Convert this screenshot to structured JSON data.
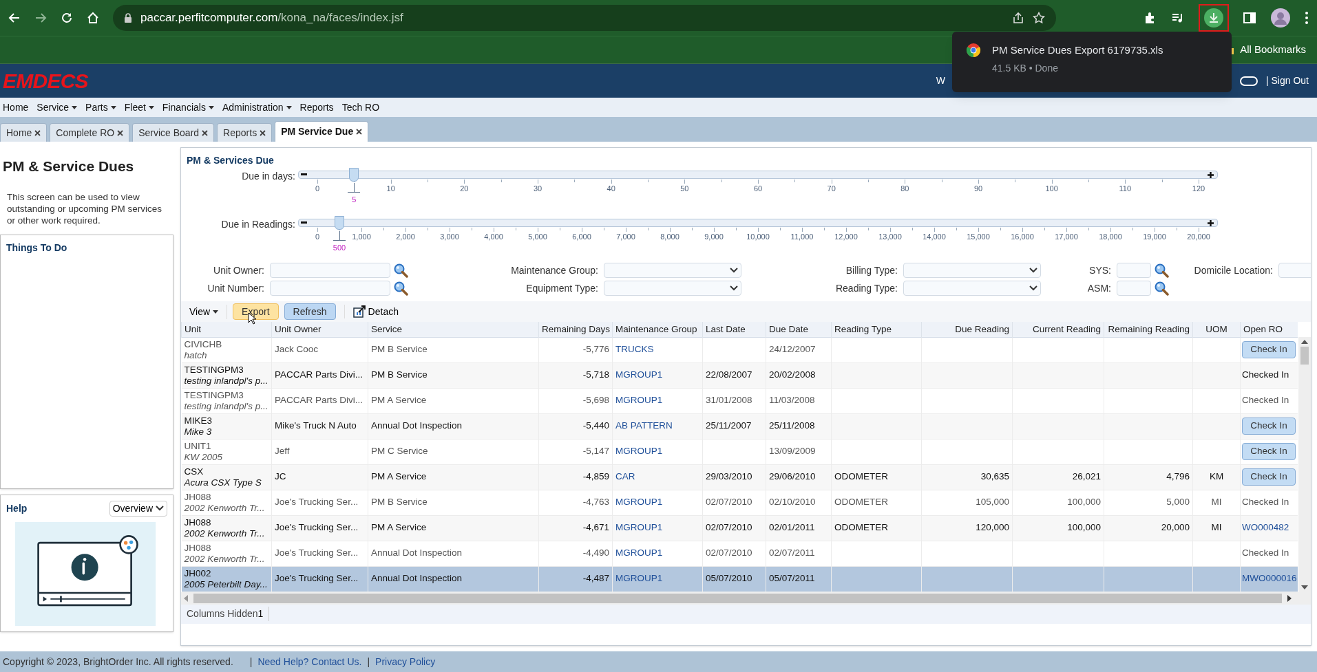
{
  "browser": {
    "url_host": "paccar.perfitcomputer.com",
    "url_path": "/kona_na/faces/index.jsf",
    "bookmarks_label": "All Bookmarks"
  },
  "download_popup": {
    "file_name": "PM Service Dues Export 6179735.xls",
    "details": "41.5 KB • Done"
  },
  "app_header": {
    "logo": "EMDECS",
    "welcome_partial": "W",
    "sign_out": "| Sign Out"
  },
  "menu": [
    {
      "label": "Home",
      "dropdown": false
    },
    {
      "label": "Service",
      "dropdown": true
    },
    {
      "label": "Parts",
      "dropdown": true
    },
    {
      "label": "Fleet",
      "dropdown": true
    },
    {
      "label": "Financials",
      "dropdown": true
    },
    {
      "label": "Administration",
      "dropdown": true
    },
    {
      "label": "Reports",
      "dropdown": false
    },
    {
      "label": "Tech RO",
      "dropdown": false
    }
  ],
  "tabs": [
    {
      "label": "Home",
      "selected": false
    },
    {
      "label": "Complete RO",
      "selected": false
    },
    {
      "label": "Service Board",
      "selected": false
    },
    {
      "label": "Reports",
      "selected": false
    },
    {
      "label": "PM Service Due",
      "selected": true
    }
  ],
  "sidebar": {
    "title": "PM & Service Dues",
    "description": "This screen can be used to view outstanding or upcoming PM services or other work required.",
    "things_to_do": "Things To Do",
    "help_title": "Help",
    "help_select": "Overview"
  },
  "panel_title": "PM & Services Due",
  "sliders": [
    {
      "label": "Due in days:",
      "level": 0.0417,
      "value": "5",
      "ticks": [
        "0",
        "10",
        "20",
        "30",
        "40",
        "50",
        "60",
        "70",
        "80",
        "90",
        "100",
        "110",
        "120"
      ]
    },
    {
      "label": "Due in Readings:",
      "level": 0.025,
      "value": "500",
      "ticks": [
        "0",
        "1,000",
        "2,000",
        "3,000",
        "4,000",
        "5,000",
        "6,000",
        "7,000",
        "8,000",
        "9,000",
        "10,000",
        "11,000",
        "12,000",
        "13,000",
        "14,000",
        "15,000",
        "16,000",
        "17,000",
        "18,000",
        "19,000",
        "20,000"
      ]
    }
  ],
  "filter_columns": [
    [
      {
        "label": "Unit Owner:",
        "kind": "lookup"
      },
      {
        "label": "Unit Number:",
        "kind": "lookup"
      }
    ],
    [
      {
        "label": "Maintenance Group:",
        "kind": "select"
      },
      {
        "label": "Equipment Type:",
        "kind": "select"
      }
    ],
    [
      {
        "label": "Billing Type:",
        "kind": "select"
      },
      {
        "label": "Reading Type:",
        "kind": "select"
      }
    ],
    [
      {
        "label": "SYS:",
        "kind": "lookup_small"
      },
      {
        "label": "ASM:",
        "kind": "lookup_small"
      }
    ],
    [
      {
        "label": "Domicile Location:",
        "kind": "text"
      }
    ]
  ],
  "toolbar": {
    "view": "View",
    "export": "Export",
    "refresh": "Refresh",
    "detach": "Detach"
  },
  "table": {
    "columns": [
      "Unit",
      "Unit Owner",
      "Service",
      "Remaining Days",
      "Maintenance Group",
      "Last Date",
      "Due Date",
      "Reading Type",
      "Due Reading",
      "Current Reading",
      "Remaining Reading",
      "UOM",
      "Open RO"
    ],
    "rows": [
      {
        "unit": "CIVICHB",
        "unit_desc": "hatch",
        "owner": "Jack Cooc",
        "service": "PM B Service",
        "remaining_days": "-5,776",
        "group": "TRUCKS",
        "last_date": "",
        "due_date": "24/12/2007",
        "reading_type": "",
        "due_reading": "",
        "current_reading": "",
        "remaining_reading": "",
        "uom": "",
        "open_ro": {
          "kind": "button",
          "text": "Check In"
        },
        "selected": false
      },
      {
        "unit": "TESTINGPM3",
        "unit_desc": "testing inlandpl's p...",
        "owner": "PACCAR Parts Divi...",
        "service": "PM B Service",
        "remaining_days": "-5,718",
        "group": "MGROUP1",
        "last_date": "22/08/2007",
        "due_date": "20/02/2008",
        "reading_type": "",
        "due_reading": "",
        "current_reading": "",
        "remaining_reading": "",
        "uom": "",
        "open_ro": {
          "kind": "text",
          "text": "Checked In"
        },
        "selected": false
      },
      {
        "unit": "TESTINGPM3",
        "unit_desc": "testing inlandpl's p...",
        "owner": "PACCAR Parts Divi...",
        "service": "PM A Service",
        "remaining_days": "-5,698",
        "group": "MGROUP1",
        "last_date": "31/01/2008",
        "due_date": "11/03/2008",
        "reading_type": "",
        "due_reading": "",
        "current_reading": "",
        "remaining_reading": "",
        "uom": "",
        "open_ro": {
          "kind": "text",
          "text": "Checked In"
        },
        "selected": false
      },
      {
        "unit": "MIKE3",
        "unit_desc": "Mike 3",
        "owner": "Mike's Truck N Auto",
        "service": "Annual Dot Inspection",
        "remaining_days": "-5,440",
        "group": "AB PATTERN",
        "last_date": "25/11/2007",
        "due_date": "25/11/2008",
        "reading_type": "",
        "due_reading": "",
        "current_reading": "",
        "remaining_reading": "",
        "uom": "",
        "open_ro": {
          "kind": "button",
          "text": "Check In"
        },
        "selected": false
      },
      {
        "unit": "UNIT1",
        "unit_desc": "KW 2005",
        "owner": "Jeff",
        "service": "PM C Service",
        "remaining_days": "-5,147",
        "group": "MGROUP1",
        "last_date": "",
        "due_date": "13/09/2009",
        "reading_type": "",
        "due_reading": "",
        "current_reading": "",
        "remaining_reading": "",
        "uom": "",
        "open_ro": {
          "kind": "button",
          "text": "Check In"
        },
        "selected": false
      },
      {
        "unit": "CSX",
        "unit_desc": "Acura CSX Type S",
        "owner": "JC",
        "service": "PM A Service",
        "remaining_days": "-4,859",
        "group": "CAR",
        "last_date": "29/03/2010",
        "due_date": "29/06/2010",
        "reading_type": "ODOMETER",
        "due_reading": "30,635",
        "current_reading": "26,021",
        "remaining_reading": "4,796",
        "uom": "KM",
        "open_ro": {
          "kind": "button",
          "text": "Check In"
        },
        "selected": false
      },
      {
        "unit": "JH088",
        "unit_desc": "2002 Kenworth Tr...",
        "owner": "Joe's Trucking Ser...",
        "service": "PM B Service",
        "remaining_days": "-4,763",
        "group": "MGROUP1",
        "last_date": "02/07/2010",
        "due_date": "02/10/2010",
        "reading_type": "ODOMETER",
        "due_reading": "105,000",
        "current_reading": "100,000",
        "remaining_reading": "5,000",
        "uom": "MI",
        "open_ro": {
          "kind": "text",
          "text": "Checked In"
        },
        "selected": false
      },
      {
        "unit": "JH088",
        "unit_desc": "2002 Kenworth Tr...",
        "owner": "Joe's Trucking Ser...",
        "service": "PM A Service",
        "remaining_days": "-4,671",
        "group": "MGROUP1",
        "last_date": "02/07/2010",
        "due_date": "02/01/2011",
        "reading_type": "ODOMETER",
        "due_reading": "120,000",
        "current_reading": "100,000",
        "remaining_reading": "20,000",
        "uom": "MI",
        "open_ro": {
          "kind": "link",
          "text": "WO000482"
        },
        "selected": false
      },
      {
        "unit": "JH088",
        "unit_desc": "2002 Kenworth Tr...",
        "owner": "Joe's Trucking Ser...",
        "service": "Annual Dot Inspection",
        "remaining_days": "-4,490",
        "group": "MGROUP1",
        "last_date": "02/07/2010",
        "due_date": "02/07/2011",
        "reading_type": "",
        "due_reading": "",
        "current_reading": "",
        "remaining_reading": "",
        "uom": "",
        "open_ro": {
          "kind": "text",
          "text": "Checked In"
        },
        "selected": false
      },
      {
        "unit": "JH002",
        "unit_desc": "2005 Peterbilt Day...",
        "owner": "Joe's Trucking Ser...",
        "service": "Annual Dot Inspection",
        "remaining_days": "-4,487",
        "group": "MGROUP1",
        "last_date": "05/07/2010",
        "due_date": "05/07/2011",
        "reading_type": "",
        "due_reading": "",
        "current_reading": "",
        "remaining_reading": "",
        "uom": "",
        "open_ro": {
          "kind": "link",
          "text": "MWO000016"
        },
        "selected": true
      }
    ],
    "footer_label": "Columns Hidden",
    "footer_count": "1"
  },
  "page_footer": [
    {
      "kind": "text",
      "text": "Copyright © 2023, BrightOrder Inc. All rights reserved."
    },
    {
      "kind": "separator",
      "text": "|"
    },
    {
      "kind": "link",
      "text": "Need Help? Contact Us."
    },
    {
      "kind": "separator",
      "text": "|"
    },
    {
      "kind": "link",
      "text": "Privacy Policy"
    }
  ]
}
